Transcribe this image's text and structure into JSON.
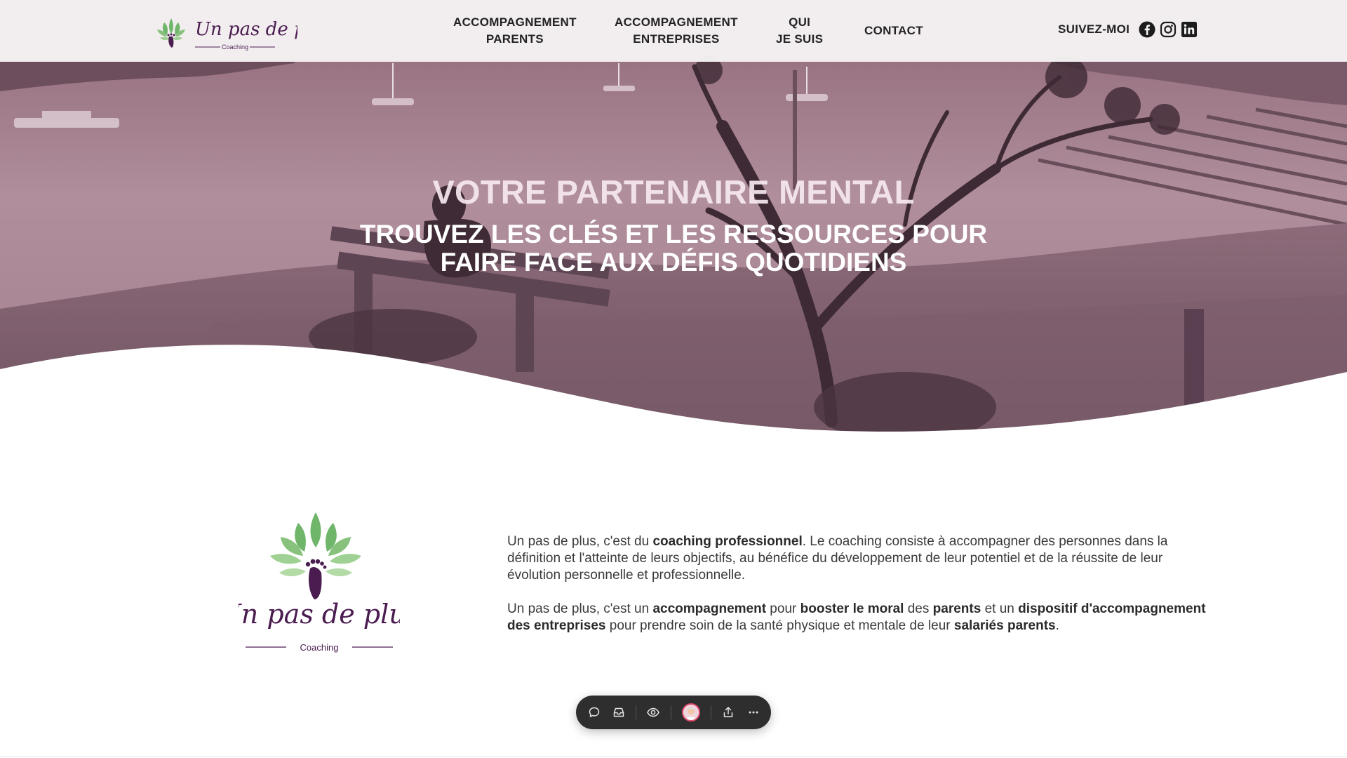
{
  "brand": {
    "name": "Un pas de plus",
    "tagline": "Coaching",
    "colors": {
      "purple": "#4a1c4f",
      "green": "#6fb56a",
      "hero_tint": "#9a7383"
    }
  },
  "nav": {
    "items": [
      {
        "line1": "ACCOMPAGNEMENT",
        "line2": "PARENTS"
      },
      {
        "line1": "ACCOMPAGNEMENT",
        "line2": "ENTREPRISES"
      },
      {
        "line1": "QUI",
        "line2": "JE SUIS"
      },
      {
        "line1": "CONTACT",
        "line2": ""
      }
    ],
    "follow_label": "SUIVEZ-MOI",
    "social_icons": [
      "facebook-icon",
      "instagram-icon",
      "linkedin-icon"
    ]
  },
  "hero": {
    "title": "VOTRE PARTENAIRE MENTAL",
    "subtitle": "TROUVEZ LES CLÉS ET LES RESSOURCES POUR FAIRE FACE AUX DÉFIS QUOTIDIENS"
  },
  "intro": {
    "p1": [
      {
        "t": "Un pas de plus, c'est du ",
        "b": false
      },
      {
        "t": "coaching professionnel",
        "b": true
      },
      {
        "t": ". Le coaching consiste à accompagner des personnes dans la définition et l'atteinte de leurs objectifs, au bénéfice du développement de leur potentiel et de la réussite de leur évolution personnelle et professionnelle.",
        "b": false
      }
    ],
    "p2": [
      {
        "t": "Un pas de plus, c'est un ",
        "b": false
      },
      {
        "t": "accompagnement",
        "b": true
      },
      {
        "t": " pour ",
        "b": false
      },
      {
        "t": "booster le moral",
        "b": true
      },
      {
        "t": " des ",
        "b": false
      },
      {
        "t": "parents",
        "b": true
      },
      {
        "t": " et un ",
        "b": false
      },
      {
        "t": "dispositif d'accompagnement des entreprises",
        "b": true
      },
      {
        "t": " pour prendre soin de la santé physique et mentale de leur ",
        "b": false
      },
      {
        "t": "salariés parents",
        "b": true
      },
      {
        "t": ".",
        "b": false
      }
    ]
  },
  "toolbar": {
    "icons": [
      "comment-icon",
      "inbox-icon",
      "eye-icon",
      "avatar",
      "share-icon",
      "more-icon"
    ]
  }
}
